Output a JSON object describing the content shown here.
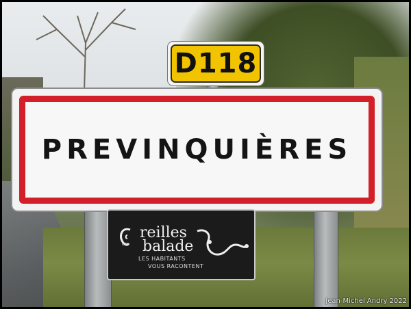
{
  "road_number": "D118",
  "town_name": "PREVINQUIÈRES",
  "lower_panel": {
    "logo_letter": "O",
    "line1": "reilles",
    "en": "en",
    "line2": "balade",
    "sub1": "LES HABITANTS",
    "sub2": "VOUS RACONTENT"
  },
  "credit": "Jean-Michel Andry 2022",
  "colors": {
    "sign_border_red": "#d31f2a",
    "road_plate_yellow": "#f2c400",
    "panel_black": "#1b1b1b"
  }
}
